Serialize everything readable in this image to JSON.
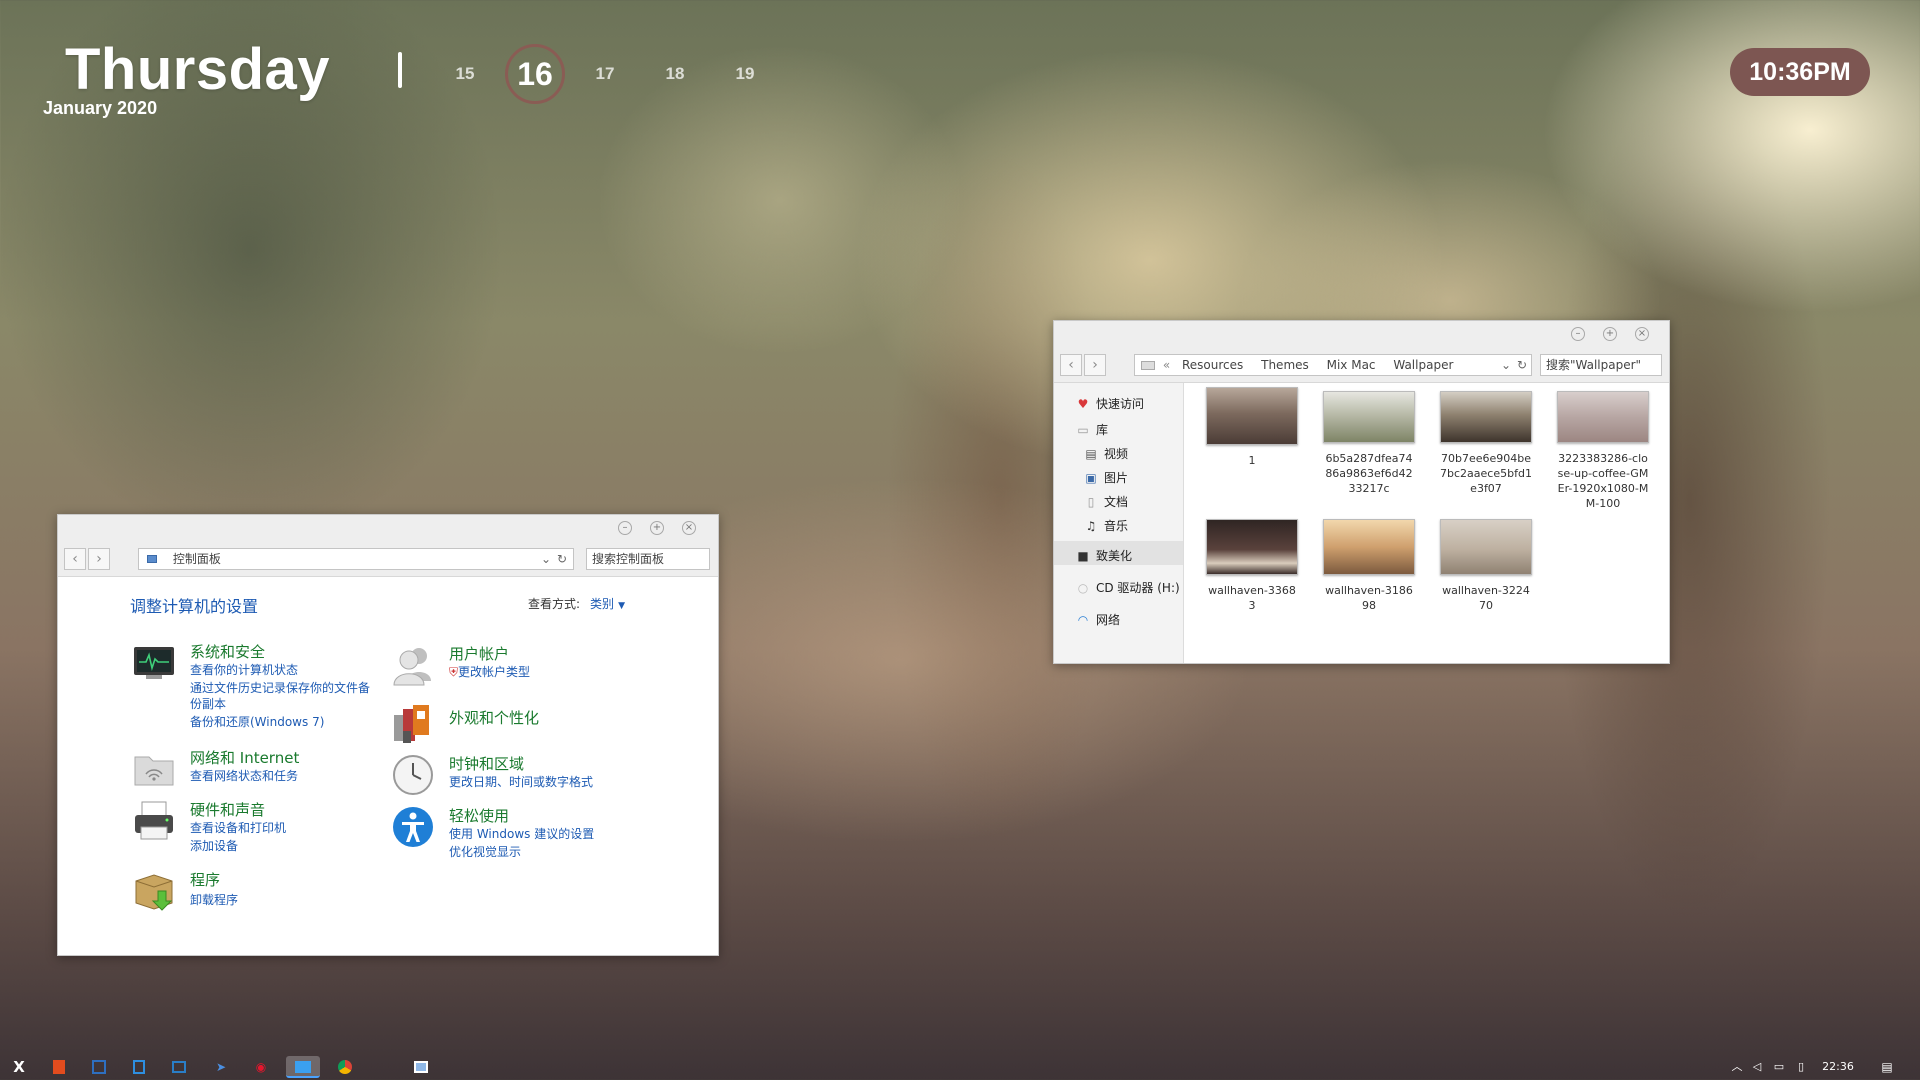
{
  "clock": {
    "weekday": "Thursday",
    "month_year": "January 2020",
    "days": [
      "15",
      "16",
      "17",
      "18",
      "19"
    ],
    "current_day": "16",
    "time": "10:36PM"
  },
  "control_panel": {
    "address": "控制面板",
    "search_placeholder": "搜索控制面板",
    "heading": "调整计算机的设置",
    "view_label": "查看方式:",
    "view_value": "类别",
    "items": [
      {
        "title": "系统和安全",
        "links": [
          "查看你的计算机状态",
          "通过文件历史记录保存你的文件备",
          "份副本",
          "备份和还原(Windows 7)"
        ]
      },
      {
        "title": "网络和 Internet",
        "links": [
          "查看网络状态和任务"
        ]
      },
      {
        "title": "硬件和声音",
        "links": [
          "查看设备和打印机",
          "添加设备"
        ]
      },
      {
        "title": "程序",
        "links": [
          "卸载程序"
        ]
      },
      {
        "title": "用户帐户",
        "links": [
          "更改帐户类型"
        ]
      },
      {
        "title": "外观和个性化",
        "links": []
      },
      {
        "title": "时钟和区域",
        "links": [
          "更改日期、时间或数字格式"
        ]
      },
      {
        "title": "轻松使用",
        "links": [
          "使用 Windows 建议的设置",
          "优化视觉显示"
        ]
      }
    ]
  },
  "file_manager": {
    "breadcrumb": [
      "Resources",
      "Themes",
      "Mix Mac",
      "Wallpaper"
    ],
    "search_placeholder": "搜索\"Wallpaper\"",
    "sidebar": [
      "快速访问",
      "库",
      "视频",
      "图片",
      "文档",
      "音乐",
      "致美化",
      "CD 驱动器 (H:)",
      "网络"
    ],
    "files": [
      {
        "name": "1",
        "color": "#6b5a50"
      },
      {
        "name": "6b5a287dfea7486a9863ef6d4233217c",
        "color": "#8c8f78"
      },
      {
        "name": "70b7ee6e904be7bc2aaece5bfd1e3f07",
        "color": "#7a6a58"
      },
      {
        "name": "3223383286-close-up-coffee-GMEr-1920x1080-MM-100",
        "color": "#b8a4a0"
      },
      {
        "name": "wallhaven-33683",
        "color": "#4a3a36"
      },
      {
        "name": "wallhaven-318698",
        "color": "#c8a070"
      },
      {
        "name": "wallhaven-322470",
        "color": "#c0b4a4"
      }
    ]
  },
  "taskbar": {
    "start_label": "X",
    "clock": "22:36"
  }
}
